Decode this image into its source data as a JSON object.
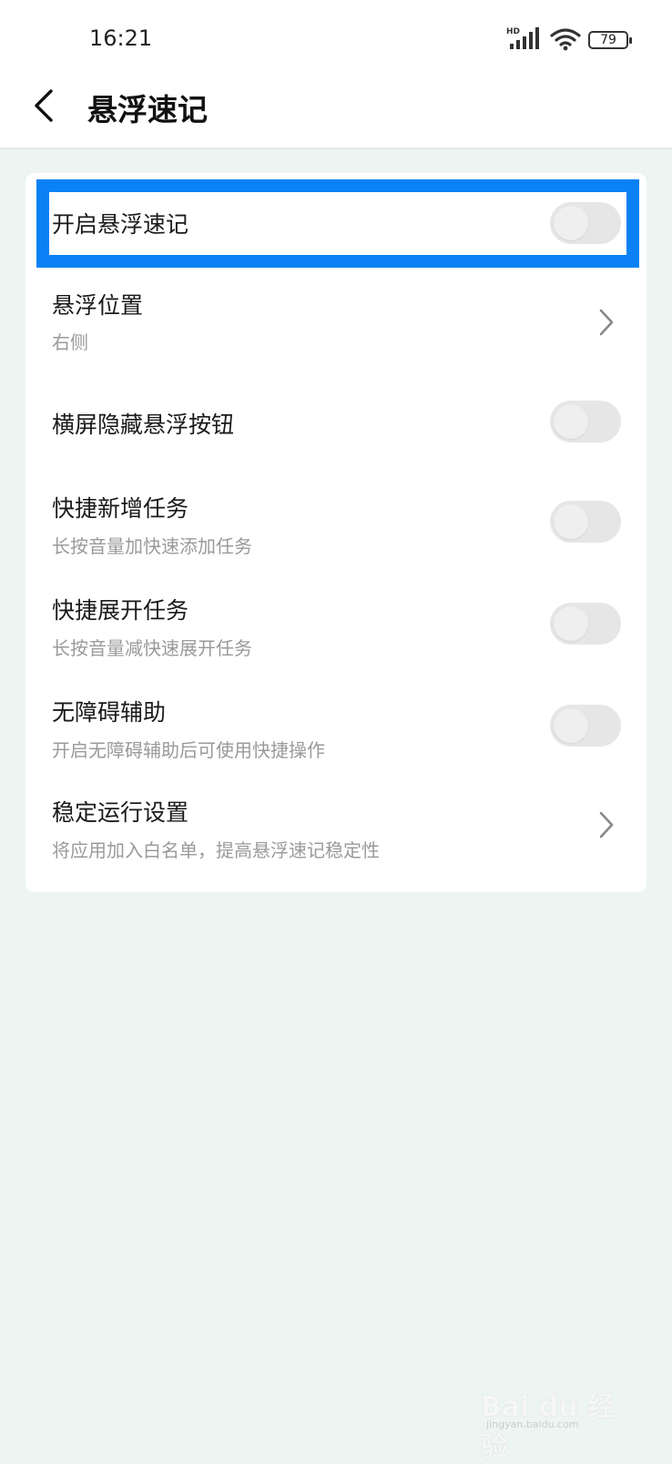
{
  "status_bar": {
    "time": "16:21",
    "network_label": "HD",
    "battery_level": "79"
  },
  "header": {
    "title": "悬浮速记"
  },
  "settings": [
    {
      "title": "开启悬浮速记",
      "subtitle": "",
      "control": "toggle",
      "on": false
    },
    {
      "title": "悬浮位置",
      "subtitle": "右侧",
      "control": "chevron"
    },
    {
      "title": "横屏隐藏悬浮按钮",
      "subtitle": "",
      "control": "toggle",
      "on": false
    },
    {
      "title": "快捷新增任务",
      "subtitle": "长按音量加快速添加任务",
      "control": "toggle",
      "on": false
    },
    {
      "title": "快捷展开任务",
      "subtitle": "长按音量减快速展开任务",
      "control": "toggle",
      "on": false
    },
    {
      "title": "无障碍辅助",
      "subtitle": "开启无障碍辅助后可使用快捷操作",
      "control": "toggle",
      "on": false
    },
    {
      "title": "稳定运行设置",
      "subtitle": "将应用加入白名单，提高悬浮速记稳定性",
      "control": "chevron"
    }
  ],
  "watermark": {
    "text": "Bai du 经验",
    "sub": "jingyan.baidu.com"
  },
  "colors": {
    "highlight": "#0a82f5",
    "background": "#edf5f2",
    "toggle_off": "#e6e6e6"
  }
}
